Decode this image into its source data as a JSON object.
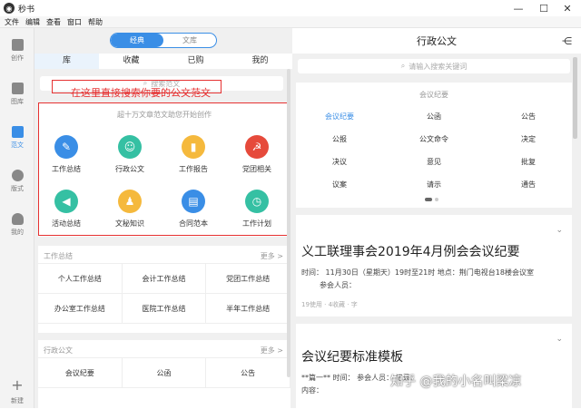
{
  "window": {
    "title": "秒书",
    "minimize": "—",
    "maximize": "☐",
    "close": "✕"
  },
  "menu": [
    "文件",
    "编辑",
    "查看",
    "窗口",
    "帮助"
  ],
  "sidebar": [
    {
      "label": "创作",
      "icon": "create-icon"
    },
    {
      "label": "图库",
      "icon": "image-icon"
    },
    {
      "label": "范文",
      "icon": "template-icon",
      "active": true
    },
    {
      "label": "版式",
      "icon": "palette-icon"
    },
    {
      "label": "我的",
      "icon": "user-icon"
    },
    {
      "label": "新建",
      "icon": "plus-icon"
    }
  ],
  "left": {
    "mode_tabs": [
      "经典",
      "文库"
    ],
    "tabs": [
      "库",
      "收藏",
      "已购",
      "我的"
    ],
    "search_placeholder": "搜索范文",
    "annotation": "在这里直接搜索你要的公文范文",
    "card_title": "超十万文章范文助您开始创作",
    "categories": [
      {
        "label": "工作总结",
        "icon": "pen-icon",
        "color": "#3a8ee6"
      },
      {
        "label": "行政公文",
        "icon": "person-icon",
        "color": "#35c0a3"
      },
      {
        "label": "工作报告",
        "icon": "book-icon",
        "color": "#f5b93d"
      },
      {
        "label": "党团相关",
        "icon": "party-icon",
        "color": "#e64a3b"
      },
      {
        "label": "活动总结",
        "icon": "megaphone-icon",
        "color": "#35c0a3"
      },
      {
        "label": "文秘知识",
        "icon": "secretary-icon",
        "color": "#f5b93d"
      },
      {
        "label": "合同范本",
        "icon": "contract-icon",
        "color": "#3a8ee6"
      },
      {
        "label": "工作计划",
        "icon": "clock-icon",
        "color": "#35c0a3"
      }
    ],
    "sections": [
      {
        "title": "工作总结",
        "more": "更多 >",
        "items": [
          "个人工作总结",
          "会计工作总结",
          "党团工作总结",
          "办公室工作总结",
          "医院工作总结",
          "半年工作总结"
        ]
      },
      {
        "title": "行政公文",
        "more": "更多 >",
        "items": [
          "会议纪要",
          "公函",
          "公告"
        ]
      }
    ]
  },
  "right": {
    "title": "行政公文",
    "search_placeholder": "请输入搜索关键词",
    "card_title": "会议纪要",
    "types": [
      "会议纪要",
      "公函",
      "公告",
      "公报",
      "公文命令",
      "决定",
      "决议",
      "意见",
      "批复",
      "议案",
      "请示",
      "通告"
    ],
    "docs": [
      {
        "title": "义工联理事会2019年4月例会会议纪要",
        "line1": "时间：  11月30日（星期天）19时至21时       地点：荆门电视台18楼会议室",
        "line2": "参会人员：",
        "meta": "19使用 · 4收藏 · 字"
      },
      {
        "title": "会议纪要标准模板",
        "line1": "**篇一**        时间：             参会人员：               记录：",
        "line2": "内容："
      }
    ]
  },
  "watermark": "知乎 @我的小名叫梁凉"
}
